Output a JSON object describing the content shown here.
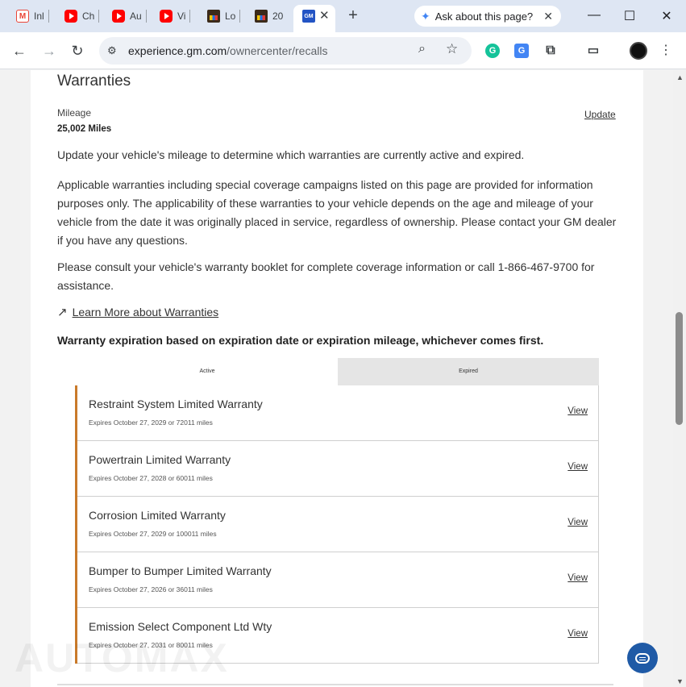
{
  "tabs": [
    {
      "title": "Inl",
      "icon": "gmail-icon"
    },
    {
      "title": "Ch",
      "icon": "youtube-icon"
    },
    {
      "title": "Au",
      "icon": "youtube-icon"
    },
    {
      "title": "Vi",
      "icon": "youtube-icon"
    },
    {
      "title": "Lo",
      "icon": "shopping-bag-icon"
    },
    {
      "title": "20",
      "icon": "shopping-bag-icon"
    }
  ],
  "active_tab": {
    "favicon_text": "GM"
  },
  "ask_chip": {
    "label": "Ask about this page?"
  },
  "address_bar": {
    "host": "experience.gm.com",
    "path": "/ownercenter/recalls"
  },
  "page": {
    "title": "Warranties",
    "mileage_label": "Mileage",
    "mileage_value": "25,002 Miles",
    "update_link": "Update",
    "para1": "Update your vehicle's mileage to determine which warranties are currently active and expired.",
    "para2": "Applicable warranties including special coverage campaigns listed on this page are provided for information purposes only. The applicability of these warranties to your vehicle depends on the age and mileage of your vehicle from the date it was originally placed in service, regardless of ownership. Please contact your GM dealer if you have any questions.",
    "para3": "Please consult your vehicle's warranty booklet for complete coverage information or call 1-866-467-9700 for assistance.",
    "learn_more": "Learn More about Warranties",
    "expiration_note": "Warranty expiration based on expiration date or expiration mileage, whichever comes first.",
    "tab_active": "Active",
    "tab_expired": "Expired",
    "warranties": [
      {
        "name": "Restraint System Limited Warranty",
        "expires": "Expires October 27, 2029 or 72011 miles",
        "view": "View"
      },
      {
        "name": "Powertrain Limited Warranty",
        "expires": "Expires October 27, 2028 or 60011 miles",
        "view": "View"
      },
      {
        "name": "Corrosion Limited Warranty",
        "expires": "Expires October 27, 2029 or 100011 miles",
        "view": "View"
      },
      {
        "name": "Bumper to Bumper Limited Warranty",
        "expires": "Expires October 27, 2026 or 36011 miles",
        "view": "View"
      },
      {
        "name": "Emission Select Component Ltd Wty",
        "expires": "Expires October 27, 2031 or 80011 miles",
        "view": "View"
      }
    ],
    "watermark": "AUTOMAX"
  },
  "colors": {
    "accent_border": "#c97a2a",
    "chat_button": "#1f5aa6"
  }
}
